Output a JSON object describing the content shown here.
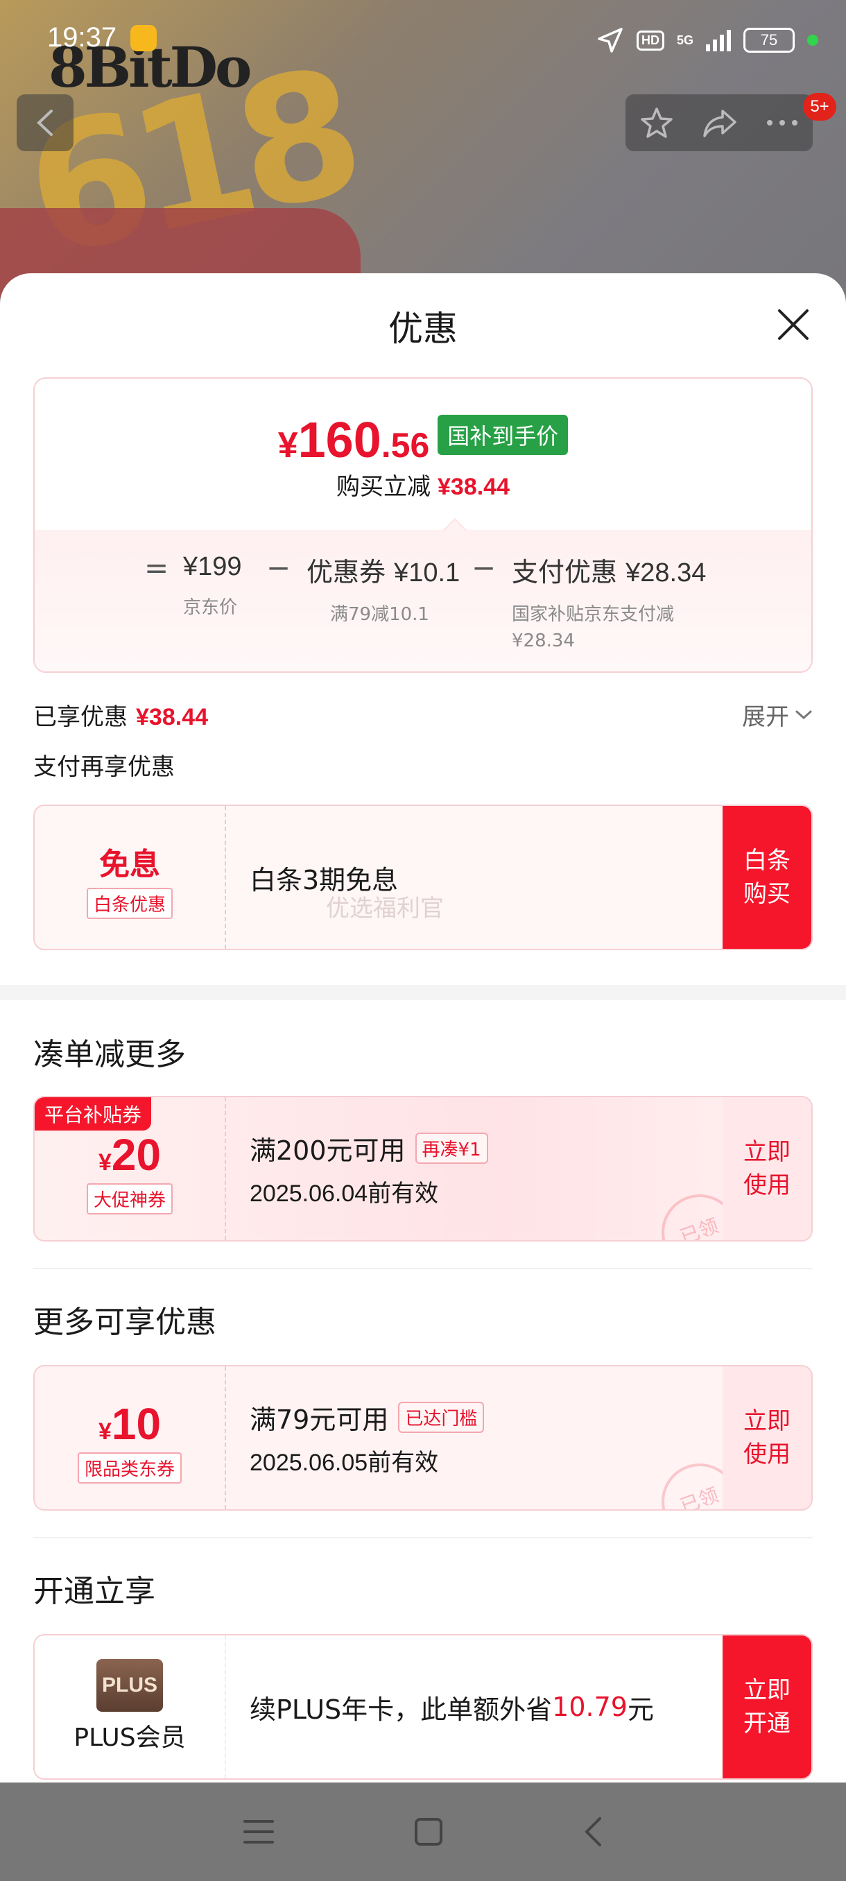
{
  "status_bar": {
    "time": "19:37",
    "hd": "HD",
    "network": "5G",
    "battery": "75"
  },
  "background": {
    "logo": "8BitDo",
    "promo": "618"
  },
  "nav": {
    "badge": "5+"
  },
  "sheet": {
    "title": "优惠",
    "price_card": {
      "currency": "¥",
      "price_int": "160",
      "price_dec": ".56",
      "tag": "国补到手价",
      "sub_label": "购买立减",
      "sub_amount": "¥38.44",
      "formula": {
        "eq": "=",
        "minus": "−",
        "items": [
          {
            "top": "¥199",
            "bottom": "京东价"
          },
          {
            "top_label": "优惠券",
            "top": "¥10.1",
            "bottom": "满79减10.1"
          },
          {
            "top_label": "支付优惠",
            "top": "¥28.34",
            "bottom": "国家补贴京东支付减¥28.34"
          }
        ]
      }
    },
    "applied": {
      "label": "已享优惠",
      "amount": "¥38.44",
      "expand": "展开"
    },
    "pay_more_label": "支付再享优惠",
    "baitiao": {
      "big": "免息",
      "label": "白条优惠",
      "text": "白条3期免息",
      "btn_line1": "白条",
      "btn_line2": "购买",
      "watermark": "优选福利官"
    },
    "section_more": "凑单减更多",
    "coupon1": {
      "platform_tag": "平台补贴券",
      "currency": "¥",
      "value": "20",
      "label": "大促神券",
      "line1": "满200元可用",
      "tag": "再凑¥1",
      "line2": "2025.06.04前有效",
      "btn_line1": "立即",
      "btn_line2": "使用",
      "stamp": "已领"
    },
    "section_available": "更多可享优惠",
    "coupon2": {
      "currency": "¥",
      "value": "10",
      "label": "限品类东券",
      "line1": "满79元可用",
      "tag": "已达门槛",
      "line2": "2025.06.05前有效",
      "btn_line1": "立即",
      "btn_line2": "使用",
      "stamp": "已领"
    },
    "section_open": "开通立享",
    "plus": {
      "logo": "PLUS",
      "name": "PLUS会员",
      "text_pre": "续PLUS年卡，此单额外省",
      "amount": "10.79",
      "text_post": "元",
      "btn_line1": "立即",
      "btn_line2": "开通"
    }
  },
  "colors": {
    "accent_red": "#e8132c",
    "button_red": "#f5162b",
    "gov_green": "#27a046"
  }
}
